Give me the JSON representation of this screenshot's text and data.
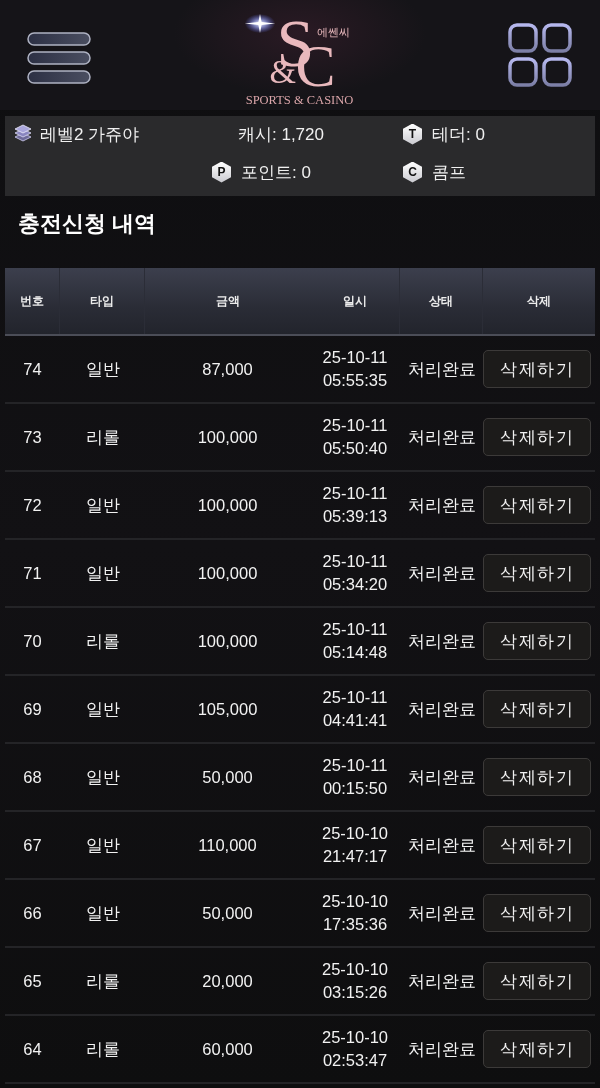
{
  "header": {
    "logo": {
      "letters": [
        "S",
        "&",
        "C"
      ],
      "subtitle": "에쎈씨",
      "tagline": "SPORTS & CASINO"
    }
  },
  "account": {
    "level": "레벨2 가쥬야",
    "items": [
      {
        "kind": "plain",
        "text": "캐시: 1,720"
      },
      {
        "kind": "badge",
        "badge": "T",
        "text": "테더: 0"
      },
      {
        "kind": "badge",
        "badge": "P",
        "text": "포인트: 0"
      },
      {
        "kind": "badge",
        "badge": "C",
        "text": "콤프"
      }
    ]
  },
  "title": "충전신청 내역",
  "table": {
    "columns": [
      "번호",
      "타입",
      "금액",
      "일시",
      "상태",
      "삭제"
    ],
    "rows": [
      {
        "no": "74",
        "type": "일반",
        "amount": "87,000",
        "datetime": "25-10-11 05:55:35",
        "status": "처리완료",
        "action": "삭제하기"
      },
      {
        "no": "73",
        "type": "리롤",
        "amount": "100,000",
        "datetime": "25-10-11 05:50:40",
        "status": "처리완료",
        "action": "삭제하기"
      },
      {
        "no": "72",
        "type": "일반",
        "amount": "100,000",
        "datetime": "25-10-11 05:39:13",
        "status": "처리완료",
        "action": "삭제하기"
      },
      {
        "no": "71",
        "type": "일반",
        "amount": "100,000",
        "datetime": "25-10-11 05:34:20",
        "status": "처리완료",
        "action": "삭제하기"
      },
      {
        "no": "70",
        "type": "리롤",
        "amount": "100,000",
        "datetime": "25-10-11 05:14:48",
        "status": "처리완료",
        "action": "삭제하기"
      },
      {
        "no": "69",
        "type": "일반",
        "amount": "105,000",
        "datetime": "25-10-11 04:41:41",
        "status": "처리완료",
        "action": "삭제하기"
      },
      {
        "no": "68",
        "type": "일반",
        "amount": "50,000",
        "datetime": "25-10-11 00:15:50",
        "status": "처리완료",
        "action": "삭제하기"
      },
      {
        "no": "67",
        "type": "일반",
        "amount": "110,000",
        "datetime": "25-10-10 21:47:17",
        "status": "처리완료",
        "action": "삭제하기"
      },
      {
        "no": "66",
        "type": "일반",
        "amount": "50,000",
        "datetime": "25-10-10 17:35:36",
        "status": "처리완료",
        "action": "삭제하기"
      },
      {
        "no": "65",
        "type": "리롤",
        "amount": "20,000",
        "datetime": "25-10-10 03:15:26",
        "status": "처리완료",
        "action": "삭제하기"
      },
      {
        "no": "64",
        "type": "리롤",
        "amount": "60,000",
        "datetime": "25-10-10 02:53:47",
        "status": "처리완료",
        "action": "삭제하기"
      }
    ]
  }
}
